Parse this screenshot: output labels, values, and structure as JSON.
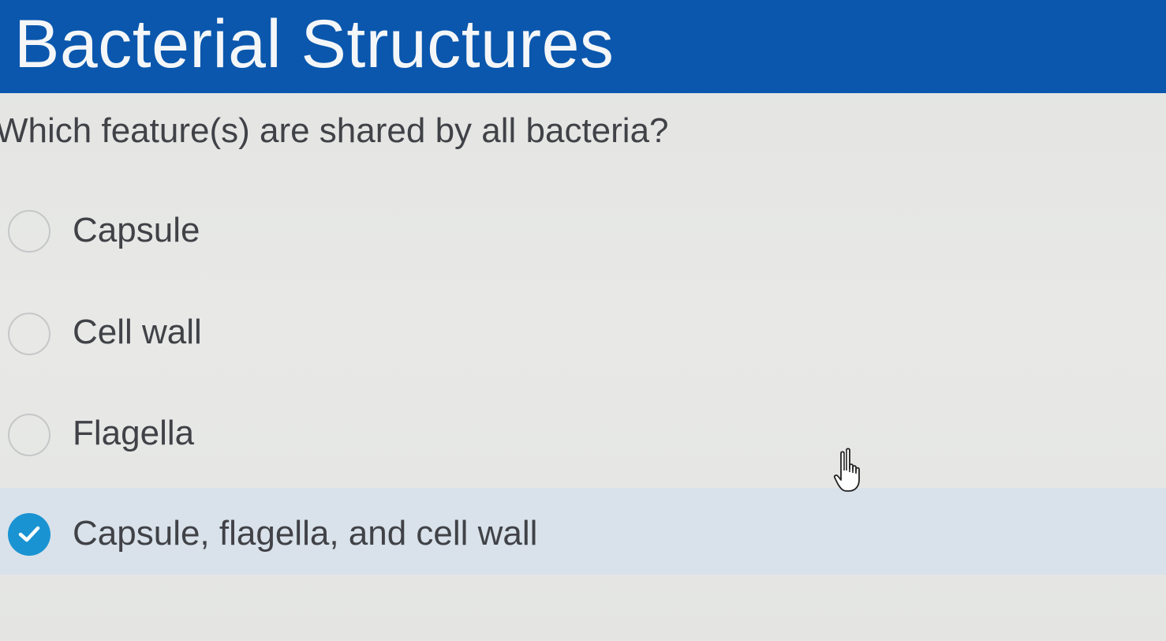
{
  "header": {
    "title": "Bacterial Structures",
    "background_color": "#0a57ad"
  },
  "question": {
    "text": "Which feature(s) are shared by all bacteria?"
  },
  "options": [
    {
      "label": "Capsule",
      "selected": false
    },
    {
      "label": "Cell wall",
      "selected": false
    },
    {
      "label": "Flagella",
      "selected": false
    },
    {
      "label": "Capsule, flagella, and cell wall",
      "selected": true
    }
  ],
  "colors": {
    "accent": "#1a93d2",
    "selected_row": "#d9e2ea",
    "text": "#404247"
  },
  "icons": {
    "radio_unchecked": "radio-unchecked-icon",
    "radio_checked": "radio-checked-icon",
    "cursor": "hand-pointer-icon"
  }
}
